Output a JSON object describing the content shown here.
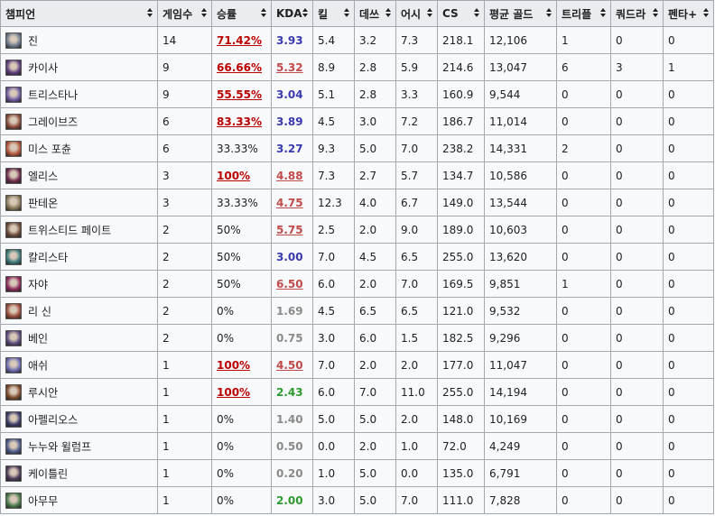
{
  "headers": {
    "champion": "챔피언",
    "games": "게임수",
    "winrate": "승률",
    "kda": "KDA",
    "kills": "킬",
    "deaths": "데쓰",
    "assists": "어시",
    "cs": "CS",
    "avg_gold": "평균 골드",
    "triple": "트리플",
    "quadra": "쿼드라",
    "penta": "펜타+"
  },
  "colors": {
    "link_red": "#ba0000",
    "kda_blue": "#3a3ab0",
    "kda_red": "#c14a4a",
    "kda_gray": "#8a8a8a",
    "kda_green": "#2e9a2e",
    "header_bg": "#eaecf0",
    "row_bg": "#f8f9fa"
  },
  "rows": [
    {
      "champion": "진",
      "icon": "jhin-portrait-icon",
      "icon_color": "#6b7a8c",
      "games": "14",
      "winrate": "71.42%",
      "winrate_style": "link",
      "kda": "3.93",
      "kda_style": "blue",
      "kills": "5.4",
      "deaths": "3.2",
      "assists": "7.3",
      "cs": "218.1",
      "avg_gold": "12,106",
      "triple": "1",
      "quadra": "0",
      "penta": "0"
    },
    {
      "champion": "카이사",
      "icon": "kaisa-portrait-icon",
      "icon_color": "#5a3d7a",
      "games": "9",
      "winrate": "66.66%",
      "winrate_style": "link",
      "kda": "5.32",
      "kda_style": "red",
      "kills": "8.9",
      "deaths": "2.8",
      "assists": "5.9",
      "cs": "214.6",
      "avg_gold": "13,047",
      "triple": "6",
      "quadra": "3",
      "penta": "1"
    },
    {
      "champion": "트리스타나",
      "icon": "tristana-portrait-icon",
      "icon_color": "#6a5aa0",
      "games": "9",
      "winrate": "55.55%",
      "winrate_style": "link",
      "kda": "3.04",
      "kda_style": "blue",
      "kills": "5.1",
      "deaths": "2.8",
      "assists": "3.3",
      "cs": "160.9",
      "avg_gold": "9,544",
      "triple": "0",
      "quadra": "0",
      "penta": "0"
    },
    {
      "champion": "그레이브즈",
      "icon": "graves-portrait-icon",
      "icon_color": "#8a4a3a",
      "games": "6",
      "winrate": "83.33%",
      "winrate_style": "link",
      "kda": "3.89",
      "kda_style": "blue",
      "kills": "4.5",
      "deaths": "3.0",
      "assists": "7.2",
      "cs": "186.7",
      "avg_gold": "11,014",
      "triple": "0",
      "quadra": "0",
      "penta": "0"
    },
    {
      "champion": "미스 포츈",
      "icon": "miss-fortune-portrait-icon",
      "icon_color": "#b0553a",
      "games": "6",
      "winrate": "33.33%",
      "winrate_style": "plain",
      "kda": "3.27",
      "kda_style": "blue",
      "kills": "9.3",
      "deaths": "5.0",
      "assists": "7.0",
      "cs": "238.2",
      "avg_gold": "14,331",
      "triple": "2",
      "quadra": "0",
      "penta": "0"
    },
    {
      "champion": "엘리스",
      "icon": "elise-portrait-icon",
      "icon_color": "#6a2a4a",
      "games": "3",
      "winrate": "100%",
      "winrate_style": "link",
      "kda": "4.88",
      "kda_style": "red",
      "kills": "7.3",
      "deaths": "2.7",
      "assists": "5.7",
      "cs": "134.7",
      "avg_gold": "10,586",
      "triple": "0",
      "quadra": "0",
      "penta": "0"
    },
    {
      "champion": "판테온",
      "icon": "pantheon-portrait-icon",
      "icon_color": "#8a7a5a",
      "games": "3",
      "winrate": "33.33%",
      "winrate_style": "plain",
      "kda": "4.75",
      "kda_style": "red",
      "kills": "12.3",
      "deaths": "4.0",
      "assists": "6.7",
      "cs": "149.0",
      "avg_gold": "13,544",
      "triple": "0",
      "quadra": "0",
      "penta": "0"
    },
    {
      "champion": "트위스티드 페이트",
      "icon": "twisted-fate-portrait-icon",
      "icon_color": "#6a4a3a",
      "games": "2",
      "winrate": "50%",
      "winrate_style": "plain",
      "kda": "5.75",
      "kda_style": "red",
      "kills": "2.5",
      "deaths": "2.0",
      "assists": "9.0",
      "cs": "189.0",
      "avg_gold": "10,603",
      "triple": "0",
      "quadra": "0",
      "penta": "0"
    },
    {
      "champion": "칼리스타",
      "icon": "kalista-portrait-icon",
      "icon_color": "#3a7a7a",
      "games": "2",
      "winrate": "50%",
      "winrate_style": "plain",
      "kda": "3.00",
      "kda_style": "blue",
      "kills": "7.0",
      "deaths": "4.5",
      "assists": "6.5",
      "cs": "255.0",
      "avg_gold": "13,620",
      "triple": "0",
      "quadra": "0",
      "penta": "0"
    },
    {
      "champion": "자야",
      "icon": "xayah-portrait-icon",
      "icon_color": "#8a2a5a",
      "games": "2",
      "winrate": "50%",
      "winrate_style": "plain",
      "kda": "6.50",
      "kda_style": "red",
      "kills": "6.0",
      "deaths": "2.0",
      "assists": "7.0",
      "cs": "169.5",
      "avg_gold": "9,851",
      "triple": "1",
      "quadra": "0",
      "penta": "0"
    },
    {
      "champion": "리 신",
      "icon": "lee-sin-portrait-icon",
      "icon_color": "#9a4a3a",
      "games": "2",
      "winrate": "0%",
      "winrate_style": "plain",
      "kda": "1.69",
      "kda_style": "gray",
      "kills": "4.5",
      "deaths": "6.5",
      "assists": "6.5",
      "cs": "121.0",
      "avg_gold": "9,532",
      "triple": "0",
      "quadra": "0",
      "penta": "0"
    },
    {
      "champion": "베인",
      "icon": "vayne-portrait-icon",
      "icon_color": "#5a4a7a",
      "games": "2",
      "winrate": "0%",
      "winrate_style": "plain",
      "kda": "0.75",
      "kda_style": "gray",
      "kills": "3.0",
      "deaths": "6.0",
      "assists": "1.5",
      "cs": "182.5",
      "avg_gold": "9,296",
      "triple": "0",
      "quadra": "0",
      "penta": "0"
    },
    {
      "champion": "애쉬",
      "icon": "ashe-portrait-icon",
      "icon_color": "#6a6ab0",
      "games": "1",
      "winrate": "100%",
      "winrate_style": "link",
      "kda": "4.50",
      "kda_style": "red",
      "kills": "7.0",
      "deaths": "2.0",
      "assists": "2.0",
      "cs": "177.0",
      "avg_gold": "11,047",
      "triple": "0",
      "quadra": "0",
      "penta": "0"
    },
    {
      "champion": "루시안",
      "icon": "lucian-portrait-icon",
      "icon_color": "#7a4a2a",
      "games": "1",
      "winrate": "100%",
      "winrate_style": "link",
      "kda": "2.43",
      "kda_style": "green",
      "kills": "6.0",
      "deaths": "7.0",
      "assists": "11.0",
      "cs": "255.0",
      "avg_gold": "14,194",
      "triple": "0",
      "quadra": "0",
      "penta": "0"
    },
    {
      "champion": "아펠리오스",
      "icon": "aphelios-portrait-icon",
      "icon_color": "#3a3a6a",
      "games": "1",
      "winrate": "0%",
      "winrate_style": "plain",
      "kda": "1.40",
      "kda_style": "gray",
      "kills": "5.0",
      "deaths": "5.0",
      "assists": "2.0",
      "cs": "148.0",
      "avg_gold": "10,169",
      "triple": "0",
      "quadra": "0",
      "penta": "0"
    },
    {
      "champion": "누누와 윌럼프",
      "icon": "nunu-portrait-icon",
      "icon_color": "#4a5a8a",
      "games": "1",
      "winrate": "0%",
      "winrate_style": "plain",
      "kda": "0.50",
      "kda_style": "gray",
      "kills": "0.0",
      "deaths": "2.0",
      "assists": "1.0",
      "cs": "72.0",
      "avg_gold": "4,249",
      "triple": "0",
      "quadra": "0",
      "penta": "0"
    },
    {
      "champion": "케이틀린",
      "icon": "caitlyn-portrait-icon",
      "icon_color": "#4a3a5a",
      "games": "1",
      "winrate": "0%",
      "winrate_style": "plain",
      "kda": "0.20",
      "kda_style": "gray",
      "kills": "1.0",
      "deaths": "5.0",
      "assists": "0.0",
      "cs": "135.0",
      "avg_gold": "6,791",
      "triple": "0",
      "quadra": "0",
      "penta": "0"
    },
    {
      "champion": "아무무",
      "icon": "amumu-portrait-icon",
      "icon_color": "#4a7a4a",
      "games": "1",
      "winrate": "0%",
      "winrate_style": "plain",
      "kda": "2.00",
      "kda_style": "green",
      "kills": "3.0",
      "deaths": "5.0",
      "assists": "7.0",
      "cs": "111.0",
      "avg_gold": "7,828",
      "triple": "0",
      "quadra": "0",
      "penta": "0"
    }
  ]
}
